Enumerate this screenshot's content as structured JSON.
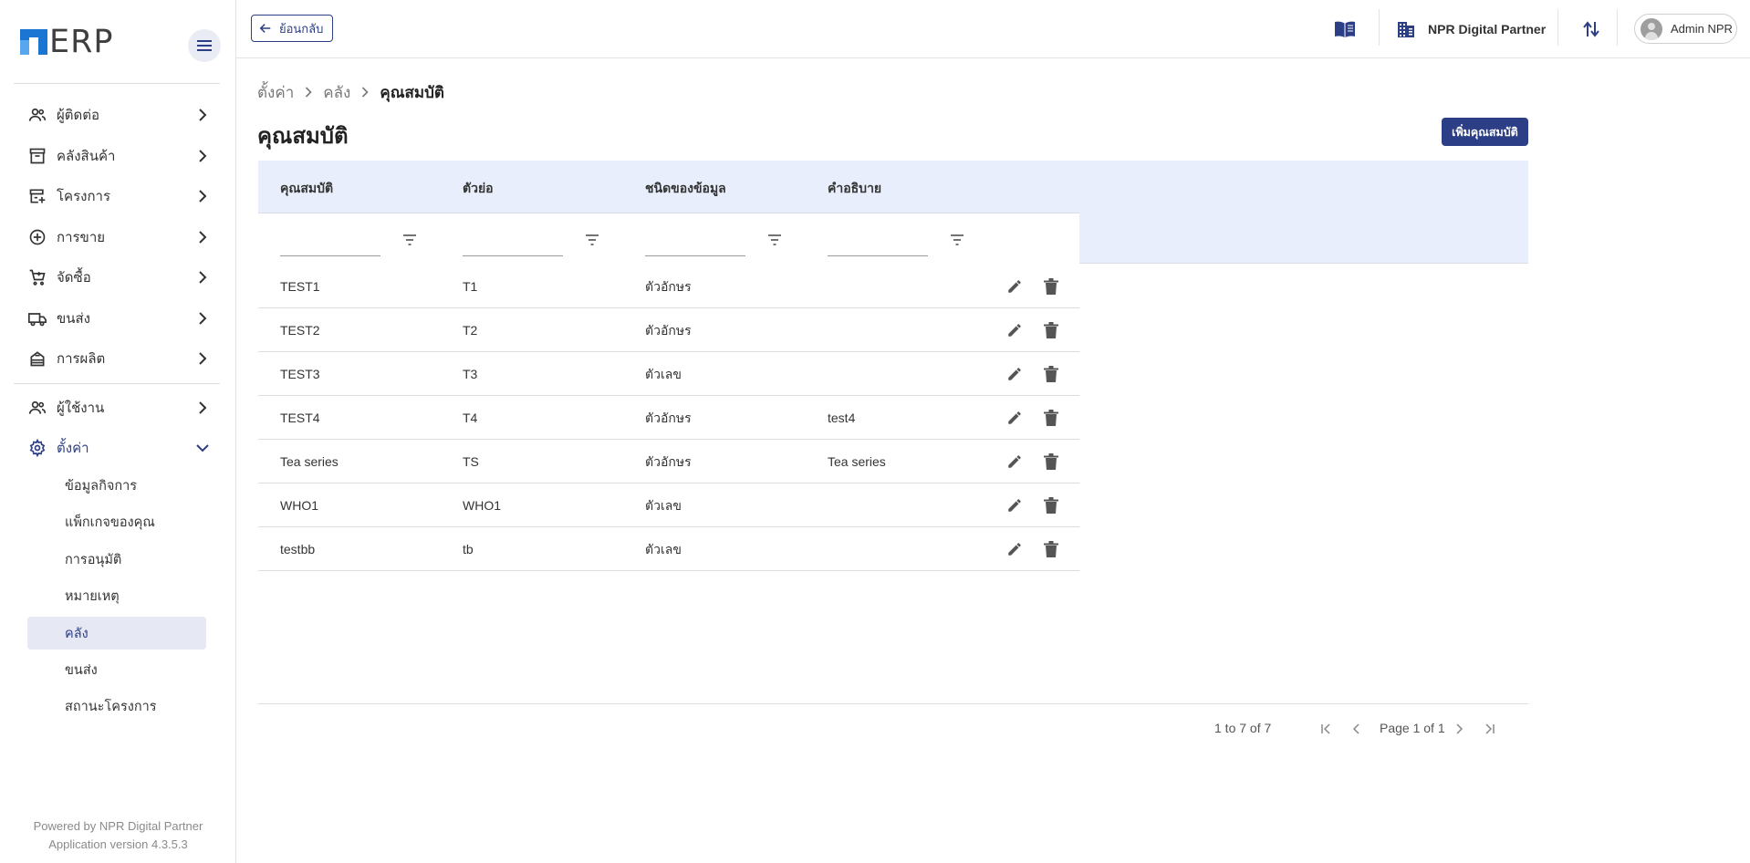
{
  "app": {
    "logo_text": "ERP",
    "brand_colors": {
      "primary": "#2c3e86",
      "logo_blue": "#1b76d3",
      "logo_light_blue": "#58a6ee"
    }
  },
  "sidebar": {
    "items": [
      {
        "label": "ผู้ติดต่อ",
        "icon": "contacts-icon"
      },
      {
        "label": "คลังสินค้า",
        "icon": "inventory-box-icon"
      },
      {
        "label": "โครงการ",
        "icon": "project-icon"
      },
      {
        "label": "การขาย",
        "icon": "plus-circle-icon"
      },
      {
        "label": "จัดซื้อ",
        "icon": "cart-icon"
      },
      {
        "label": "ขนส่ง",
        "icon": "truck-icon"
      },
      {
        "label": "การผลิต",
        "icon": "factory-icon"
      },
      {
        "label": "ผู้ใช้งาน",
        "icon": "users-icon"
      },
      {
        "label": "ตั้งค่า",
        "icon": "settings-gear-icon"
      }
    ],
    "settings_sub_items": [
      {
        "label": "ข้อมูลกิจการ"
      },
      {
        "label": "แพ็กเกจของคุณ"
      },
      {
        "label": "การอนุมัติ"
      },
      {
        "label": "หมายเหตุ"
      },
      {
        "label": "คลัง"
      },
      {
        "label": "ขนส่ง"
      },
      {
        "label": "สถานะโครงการ"
      }
    ],
    "footer": {
      "powered_by": "Powered by NPR Digital Partner",
      "version": "Application version 4.3.5.3"
    }
  },
  "topbar": {
    "back_label": "ย้อนกลับ",
    "company_name": "NPR Digital Partner",
    "user_name": "Admin NPR"
  },
  "breadcrumb": {
    "items": [
      "ตั้งค่า",
      "คลัง"
    ],
    "current": "คุณสมบัติ"
  },
  "page": {
    "title": "คุณสมบัติ",
    "add_button": "เพิ่มคุณสมบัติ"
  },
  "table": {
    "columns": [
      "คุณสมบัติ",
      "ตัวย่อ",
      "ชนิดของข้อมูล",
      "คำอธิบาย"
    ],
    "rows": [
      {
        "name": "TEST1",
        "abbr": "T1",
        "type": "ตัวอักษร",
        "desc": ""
      },
      {
        "name": "TEST2",
        "abbr": "T2",
        "type": "ตัวอักษร",
        "desc": ""
      },
      {
        "name": "TEST3",
        "abbr": "T3",
        "type": "ตัวเลข",
        "desc": ""
      },
      {
        "name": "TEST4",
        "abbr": "T4",
        "type": "ตัวอักษร",
        "desc": "test4"
      },
      {
        "name": "Tea series",
        "abbr": "TS",
        "type": "ตัวอักษร",
        "desc": "Tea series"
      },
      {
        "name": "WHO1",
        "abbr": "WHO1",
        "type": "ตัวเลข",
        "desc": ""
      },
      {
        "name": "testbb",
        "abbr": "tb",
        "type": "ตัวเลข",
        "desc": ""
      }
    ]
  },
  "pagination": {
    "range": "1 to 7 of 7",
    "page": "Page 1 of 1"
  }
}
